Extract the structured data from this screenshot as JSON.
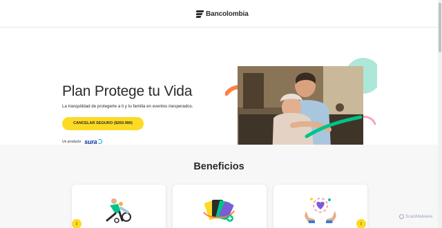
{
  "header": {
    "brand": "Bancolombia"
  },
  "hero": {
    "title": "Plan Protege tu Vida",
    "subtitle": "La tranquilidad de protegerte a ti y tu familia en eventos inesperados.",
    "cta_label": "CANCELAR SEGURO ($269.990)",
    "partner_label": "Un producto",
    "partner_brand": "sura"
  },
  "benefits": {
    "title": "Beneficios",
    "cards": [
      {
        "icon": "family-bike-illustration-icon"
      },
      {
        "icon": "cards-illustration-icon"
      },
      {
        "icon": "hands-heart-illustration-icon"
      }
    ]
  },
  "watermark": "ScanMalware",
  "colors": {
    "brand_yellow": "#fdda24",
    "text_dark": "#2c2a29",
    "accent_teal": "#00c389",
    "accent_orange": "#ff7f41",
    "accent_pink": "#f5a6b8",
    "sura_blue": "#0033a0"
  }
}
